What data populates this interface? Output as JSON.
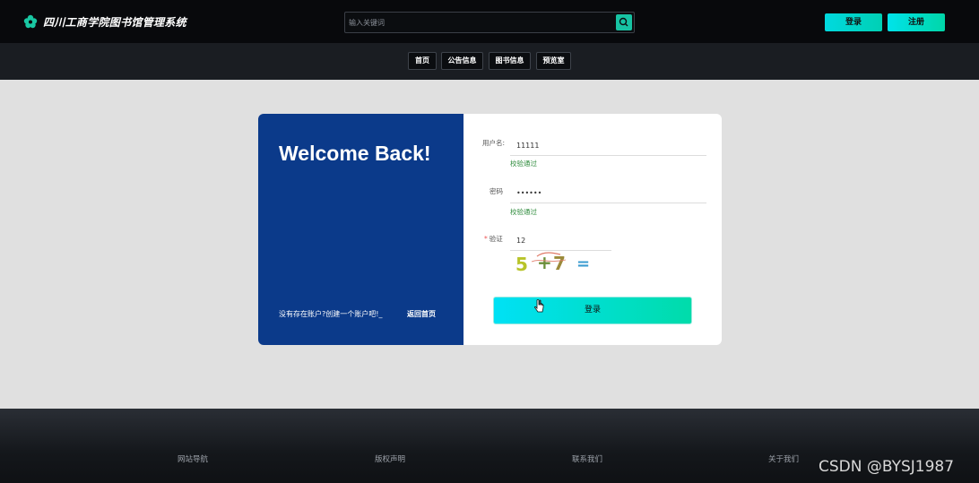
{
  "header": {
    "site_title": "四川工商学院图书馆管理系统",
    "logo_icon": "flower-logo-icon",
    "search": {
      "placeholder": "输入关键词",
      "value": "",
      "icon": "search-icon"
    },
    "login_label": "登录",
    "register_label": "注册"
  },
  "nav": {
    "items": [
      {
        "label": "首页"
      },
      {
        "label": "公告信息"
      },
      {
        "label": "图书信息"
      },
      {
        "label": "预览室"
      }
    ]
  },
  "login_card": {
    "welcome": "Welcome Back!",
    "create_account": "没有存在账户?创建一个账户吧!_",
    "back_home": "返回首页",
    "username": {
      "label": "用户名:",
      "value": "11111",
      "status": "校验通过"
    },
    "password": {
      "label": "密码",
      "value": "111111",
      "status": "校验通过"
    },
    "captcha": {
      "required_mark": "*",
      "label": "验证",
      "value": "12",
      "image_text": "5 +7 ="
    },
    "submit_label": "登录"
  },
  "footer": {
    "links": [
      "网站导航",
      "版权声明",
      "联系我们",
      "关于我们"
    ],
    "watermark": "CSDN @BYSJ1987"
  },
  "colors": {
    "accent": "#00d9c8",
    "card_left": "#0b3a8a",
    "valid": "#2e8b3c"
  }
}
